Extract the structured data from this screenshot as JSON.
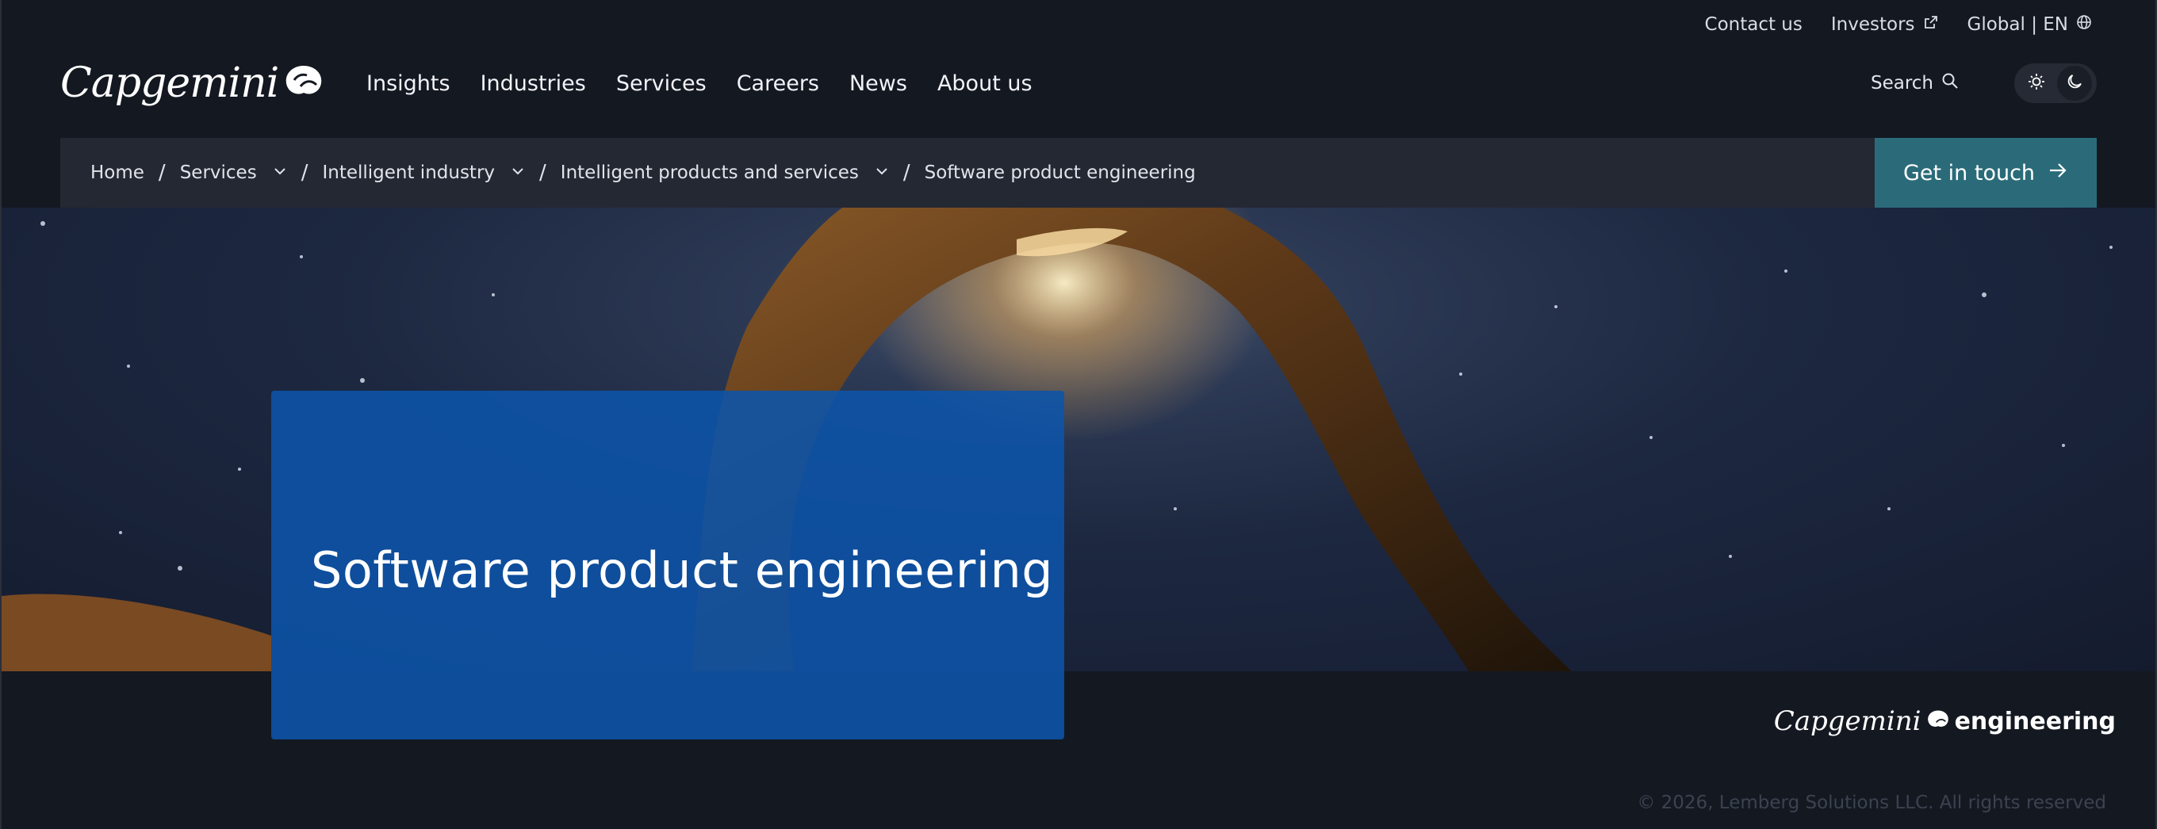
{
  "utility": {
    "contact": "Contact us",
    "investors": "Investors",
    "locale": "Global | EN"
  },
  "brand": {
    "logo": "Capgemini"
  },
  "nav": {
    "items": [
      "Insights",
      "Industries",
      "Services",
      "Careers",
      "News",
      "About us"
    ]
  },
  "header": {
    "search_label": "Search"
  },
  "breadcrumb": {
    "items": [
      "Home",
      "Services",
      "Intelligent industry",
      "Intelligent products and services",
      "Software product engineering"
    ]
  },
  "cta": {
    "label": "Get in touch"
  },
  "hero": {
    "title": "Software product engineering"
  },
  "footer": {
    "logo_word": "Capgemini",
    "logo_suffix": "engineering",
    "copyright": "© 2026, Lemberg Solutions LLC. All rights reserved"
  },
  "colors": {
    "background": "#141821",
    "cta": "#2b6b79",
    "title_card": "#0c54aa"
  }
}
